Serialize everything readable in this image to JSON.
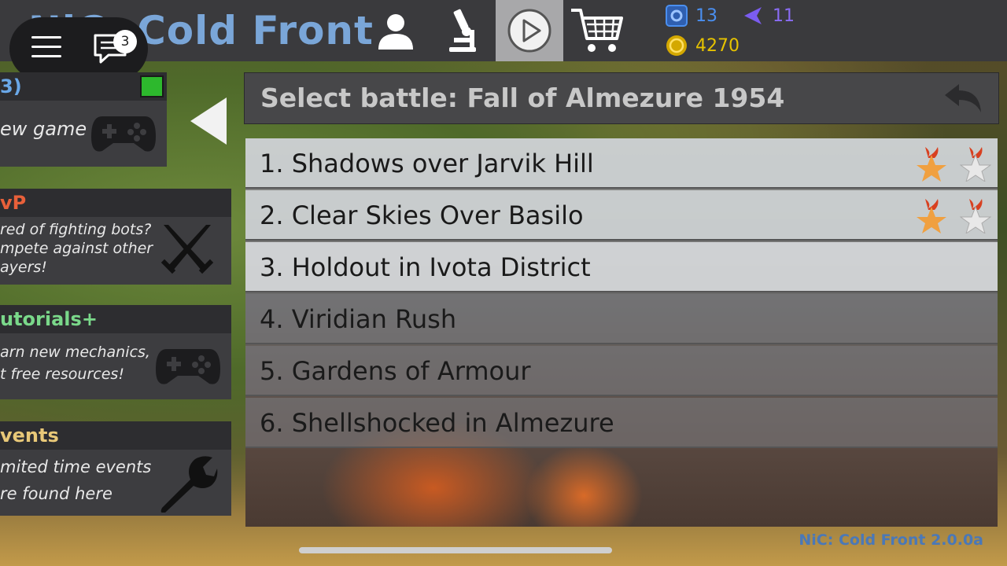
{
  "app": {
    "title": "NiC: Cold Front",
    "version": "NiC: Cold Front 2.0.0a"
  },
  "topbar": {
    "chat_badge": "3",
    "nav": [
      {
        "id": "profile",
        "icon": "person-icon"
      },
      {
        "id": "research",
        "icon": "microscope-icon"
      },
      {
        "id": "play",
        "icon": "play-icon",
        "active": true
      },
      {
        "id": "shop",
        "icon": "cart-icon"
      }
    ],
    "currencies": {
      "gear_value": "13",
      "intel_value": "11",
      "coins_value": "4270"
    },
    "colors": {
      "gear": "#4a8ff0",
      "intel": "#7b5cf0",
      "coins": "#e6c200"
    }
  },
  "left_menu": {
    "newgame": {
      "header": "3)",
      "label": "ew game"
    },
    "pvp": {
      "header": "vP",
      "desc_line1": "red of fighting bots?",
      "desc_line2": "mpete against other",
      "desc_line3": "ayers!"
    },
    "tutorials": {
      "header": "utorials+",
      "desc_line1": "arn new mechanics,",
      "desc_line2": "t free resources!"
    },
    "events": {
      "header": "vents",
      "desc_line1": "mited time events",
      "desc_line2": "re found here"
    },
    "colors": {
      "newgame_header": "#6aa8e8",
      "pvp_header": "#e8603a",
      "tutorials_header": "#7ad88a",
      "events_header": "#e8c878",
      "status_green": "#2db82d"
    }
  },
  "battle": {
    "title": "Select battle: Fall of Almezure 1954",
    "items": [
      {
        "label": "1. Shadows over Jarvik Hill",
        "stars": [
          true,
          false
        ]
      },
      {
        "label": "2. Clear Skies Over Basilo",
        "stars": [
          true,
          false
        ]
      },
      {
        "label": "3. Holdout in Ivota District"
      },
      {
        "label": "4. Viridian Rush"
      },
      {
        "label": "5. Gardens of Armour"
      },
      {
        "label": "6. Shellshocked in Almezure"
      }
    ]
  }
}
